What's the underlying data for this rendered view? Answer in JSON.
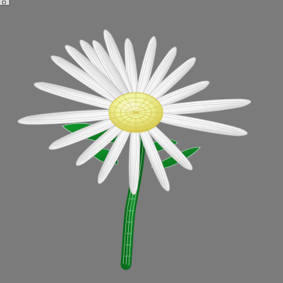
{
  "viewport": {
    "background_color": "#7b7b7b",
    "corner_icon": "viewport-menu-icon"
  },
  "scene": {
    "object_type": "3d-daisy-wireframe-model",
    "colors": {
      "petal_fill": "#f4f4f4",
      "petal_shadow": "#c7c7c7",
      "petal_wire": "#bdbdbd",
      "center_fill": "#ecef9e",
      "center_wire": "#d5c247",
      "stem_fill": "#0f7d20",
      "stem_wire": "#d8efe0",
      "leaf_fill": "#0e8424"
    },
    "visible_parts": [
      "petals",
      "flower-center",
      "stem",
      "leaves"
    ]
  }
}
